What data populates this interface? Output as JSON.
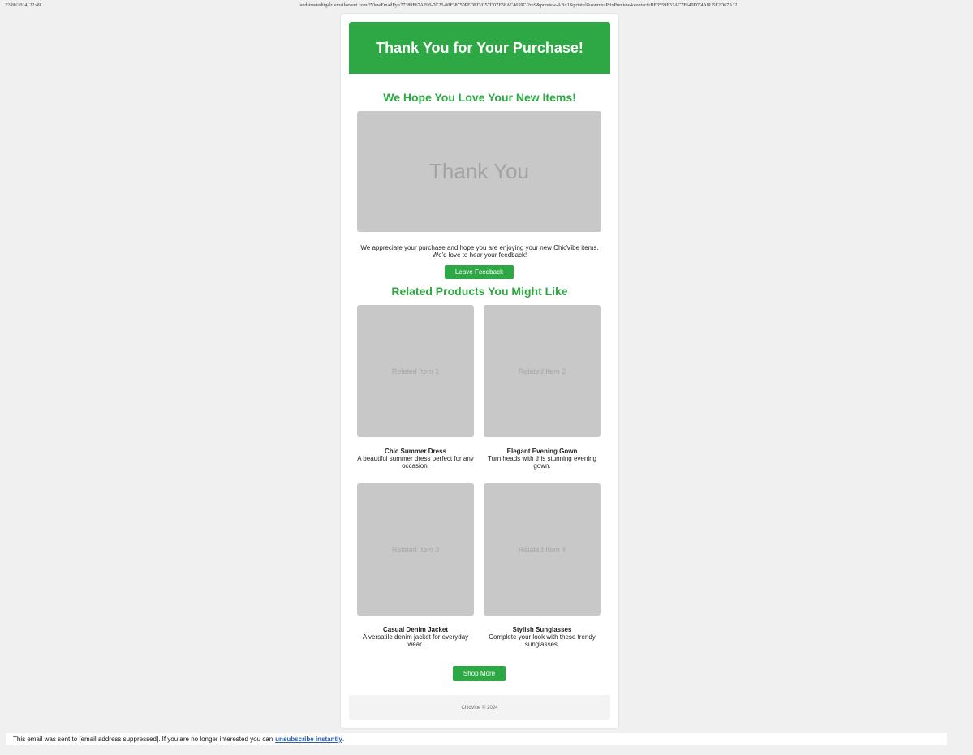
{
  "browser": {
    "date": "22/08/2024, 22:49",
    "url": "landstreeteditgelc.emailsevent.com/?ViewEmailFy=77389F67AF00-7C25-00F38750PEDED/C57D0ZF58AC4659C/?r=9&preview-AB=1&print=l&source=PrixPreview&contact=BE3559E32AC7F640D7/4A8U5E2D67A32"
  },
  "email": {
    "header_title": "Thank You for Your Purchase!",
    "hero_heading": "We Hope You Love Your New Items!",
    "hero_image_text": "Thank You",
    "intro_text": "We appreciate your purchase and hope you are enjoying your new ChicVibe items. We'd love to hear your feedback!",
    "feedback_button": "Leave Feedback",
    "related_heading": "Related Products You Might Like",
    "products": [
      {
        "image_text": "Related Item 1",
        "name": "Chic Summer Dress",
        "description": "A beautiful summer dress perfect for any occasion."
      },
      {
        "image_text": "Related Item 2",
        "name": "Elegant Evening Gown",
        "description": "Turn heads with this stunning evening gown."
      },
      {
        "image_text": "Related Item 3",
        "name": "Casual Denim Jacket",
        "description": "A versatile denim jacket for everyday wear."
      },
      {
        "image_text": "Related Item 4",
        "name": "Stylish Sunglasses",
        "description": "Complete your look with these trendy sunglasses."
      }
    ],
    "shop_button": "Shop More",
    "footer_text": "ChicVibe © 2024"
  },
  "bottom_notice": {
    "text": "This email was sent to [email address suppressed]. If you are no longer interested you can",
    "link": "unsubscribe instantly",
    "suffix": "."
  },
  "colors": {
    "brand_green": "#2ea844",
    "placeholder_gray": "#c8c8c8",
    "link_blue": "#2a5db0"
  }
}
